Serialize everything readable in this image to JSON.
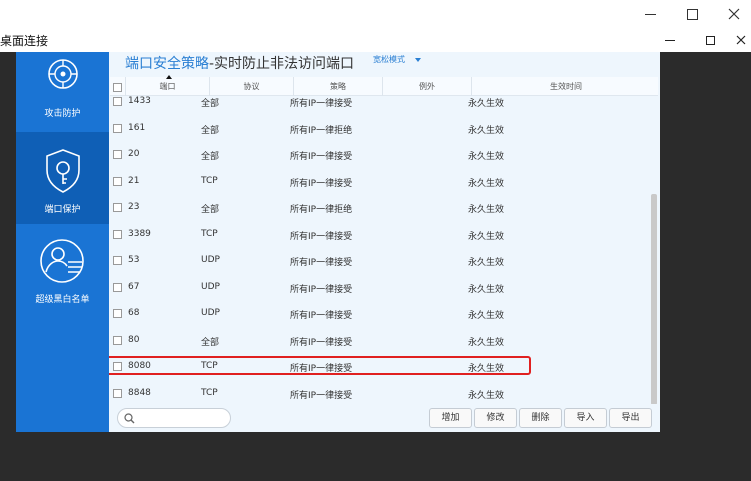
{
  "remote_desktop": {
    "title": "桌面连接"
  },
  "sidebar": {
    "items": [
      {
        "label": "攻击防护",
        "icon": "attack-shield-icon"
      },
      {
        "label": "端口保护",
        "icon": "port-lock-icon"
      },
      {
        "label": "超级黑白名单",
        "icon": "user-list-icon"
      }
    ]
  },
  "header": {
    "title_accent": "端口安全策略",
    "title_rest": "-实时防止非法访问端口",
    "mode": "宽松模式"
  },
  "table": {
    "columns": [
      "端口",
      "协议",
      "策略",
      "例外",
      "生效时间"
    ],
    "rows": [
      {
        "port": "1433",
        "protocol": "全部",
        "policy": "所有IP一律接受",
        "exception": "",
        "effect": "永久生效"
      },
      {
        "port": "161",
        "protocol": "全部",
        "policy": "所有IP一律拒绝",
        "exception": "",
        "effect": "永久生效"
      },
      {
        "port": "20",
        "protocol": "全部",
        "policy": "所有IP一律接受",
        "exception": "",
        "effect": "永久生效"
      },
      {
        "port": "21",
        "protocol": "TCP",
        "policy": "所有IP一律接受",
        "exception": "",
        "effect": "永久生效"
      },
      {
        "port": "23",
        "protocol": "全部",
        "policy": "所有IP一律拒绝",
        "exception": "",
        "effect": "永久生效"
      },
      {
        "port": "3389",
        "protocol": "TCP",
        "policy": "所有IP一律接受",
        "exception": "",
        "effect": "永久生效"
      },
      {
        "port": "53",
        "protocol": "UDP",
        "policy": "所有IP一律接受",
        "exception": "",
        "effect": "永久生效"
      },
      {
        "port": "67",
        "protocol": "UDP",
        "policy": "所有IP一律接受",
        "exception": "",
        "effect": "永久生效"
      },
      {
        "port": "68",
        "protocol": "UDP",
        "policy": "所有IP一律接受",
        "exception": "",
        "effect": "永久生效"
      },
      {
        "port": "80",
        "protocol": "全部",
        "policy": "所有IP一律接受",
        "exception": "",
        "effect": "永久生效"
      },
      {
        "port": "8080",
        "protocol": "TCP",
        "policy": "所有IP一律接受",
        "exception": "",
        "effect": "永久生效"
      },
      {
        "port": "8848",
        "protocol": "TCP",
        "policy": "所有IP一律接受",
        "exception": "",
        "effect": "永久生效"
      }
    ]
  },
  "search": {
    "placeholder": ""
  },
  "buttons": {
    "add": "增加",
    "edit": "修改",
    "delete": "删除",
    "import": "导入",
    "export": "导出"
  },
  "colors": {
    "sidebar": "#1a74d4",
    "accent": "#2a7fd3",
    "highlight": "#e02020"
  }
}
